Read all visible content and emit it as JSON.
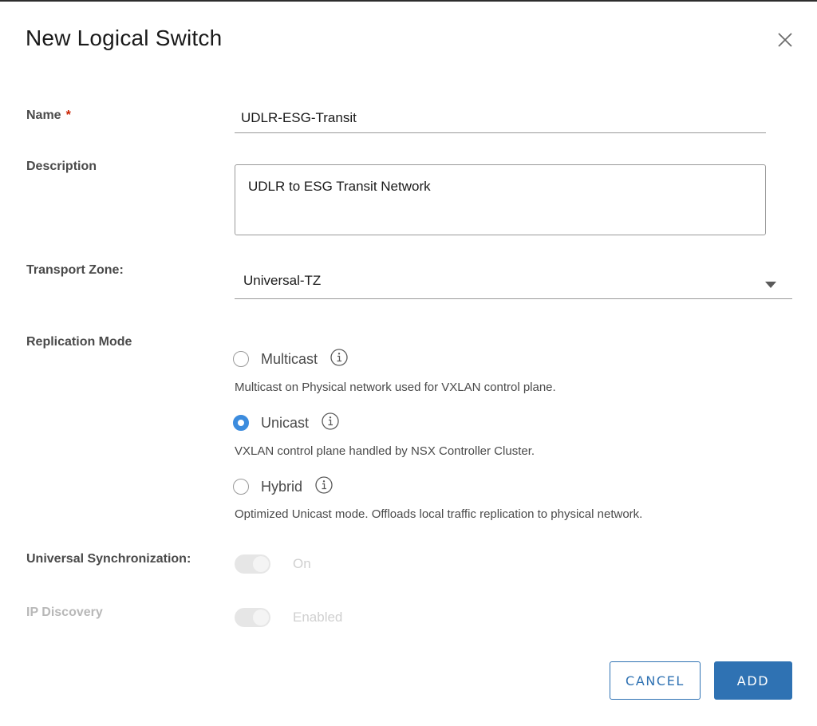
{
  "dialog": {
    "title": "New Logical Switch"
  },
  "form": {
    "name": {
      "label": "Name",
      "required_marker": "*",
      "value": "UDLR-ESG-Transit"
    },
    "description": {
      "label": "Description",
      "value": "UDLR to ESG Transit Network"
    },
    "transport_zone": {
      "label": "Transport Zone:",
      "selected": "Universal-TZ"
    },
    "replication_mode": {
      "label": "Replication Mode",
      "options": [
        {
          "label": "Multicast",
          "help": "Multicast on Physical network used for VXLAN control plane.",
          "checked": false
        },
        {
          "label": "Unicast",
          "help": "VXLAN control plane handled by NSX Controller Cluster.",
          "checked": true
        },
        {
          "label": "Hybrid",
          "help": "Optimized Unicast mode. Offloads local traffic replication to physical network.",
          "checked": false
        }
      ]
    },
    "universal_sync": {
      "label": "Universal Synchronization:",
      "state": "On"
    },
    "ip_discovery": {
      "label": "IP Discovery",
      "state": "Enabled"
    }
  },
  "buttons": {
    "cancel": "CANCEL",
    "add": "ADD"
  },
  "colors": {
    "accent": "#3c8cde",
    "primary_button": "#2f72b3",
    "required": "#c92100"
  }
}
